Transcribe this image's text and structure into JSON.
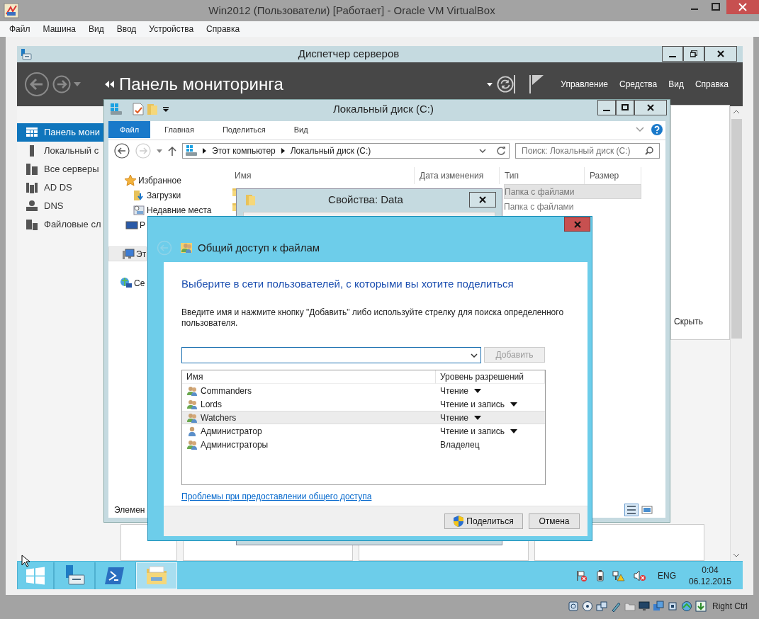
{
  "vbox": {
    "title": "Win2012 (Пользователи) [Работает] - Oracle VM VirtualBox",
    "menu": [
      "Файл",
      "Машина",
      "Вид",
      "Ввод",
      "Устройства",
      "Справка"
    ],
    "host_key": "Right Ctrl"
  },
  "server_manager": {
    "title": "Диспетчер серверов",
    "heading": "Панель мониторинга",
    "menu": [
      "Управление",
      "Средства",
      "Вид",
      "Справка"
    ],
    "sidebar": [
      {
        "label": "Панель мони",
        "kind": "dashboard",
        "selected": true
      },
      {
        "label": "Локальный с",
        "kind": "server",
        "selected": false
      },
      {
        "label": "Все серверы",
        "kind": "servers",
        "selected": false
      },
      {
        "label": "AD DS",
        "kind": "adds",
        "selected": false
      },
      {
        "label": "DNS",
        "kind": "dns",
        "selected": false
      },
      {
        "label": "Файловые сл",
        "kind": "files",
        "selected": false
      }
    ],
    "panel_link": "Скрыть"
  },
  "explorer": {
    "title": "Локальный диск (C:)",
    "ribbon_tabs": [
      {
        "label": "Файл",
        "selected": true
      },
      {
        "label": "Главная",
        "selected": false
      },
      {
        "label": "Поделиться",
        "selected": false
      },
      {
        "label": "Вид",
        "selected": false
      }
    ],
    "breadcrumb": [
      "Этот компьютер",
      "Локальный диск (C:)"
    ],
    "search": {
      "placeholder": "Поиск: Локальный диск (C:)"
    },
    "columns": [
      "Имя",
      "Дата изменения",
      "Тип",
      "Размер"
    ],
    "rows": [
      {
        "type": "Папка с файлами",
        "selected": true
      },
      {
        "type": "Папка с файлами",
        "selected": false
      }
    ],
    "nav": [
      {
        "label": "Избранное",
        "kind": "star",
        "selected": false
      },
      {
        "label": "Загрузки",
        "kind": "download",
        "selected": false
      },
      {
        "label": "Недавние места",
        "kind": "recent",
        "selected": false
      },
      {
        "label": "Р",
        "kind": "desktop",
        "selected": false
      },
      {
        "label": "Эт",
        "kind": "computer",
        "selected": true
      },
      {
        "label": "Се",
        "kind": "network",
        "selected": false
      }
    ],
    "status": "Элемен"
  },
  "properties": {
    "title": "Свойства: Data"
  },
  "share_dialog": {
    "title": "Общий доступ к файлам",
    "heading": "Выберите в сети пользователей, с которыми вы хотите поделиться",
    "instructions": "Введите имя и нажмите кнопку \"Добавить\" либо используйте стрелку для поиска определенного пользователя.",
    "add_button": {
      "label": "Добавить",
      "disabled": true
    },
    "columns": [
      "Имя",
      "Уровень разрешений"
    ],
    "entries": [
      {
        "name": "Commanders",
        "kind": "group",
        "permission": "Чтение",
        "dropdown": true,
        "selected": false
      },
      {
        "name": "Lords",
        "kind": "group",
        "permission": "Чтение и запись",
        "dropdown": true,
        "selected": false
      },
      {
        "name": "Watchers",
        "kind": "group",
        "permission": "Чтение",
        "dropdown": true,
        "selected": true
      },
      {
        "name": "Администратор",
        "kind": "user",
        "permission": "Чтение и запись",
        "dropdown": true,
        "selected": false
      },
      {
        "name": "Администраторы",
        "kind": "group",
        "permission": "Владелец",
        "dropdown": false,
        "selected": false
      }
    ],
    "link": "Проблемы при предоставлении общего доступа",
    "buttons": [
      {
        "label": "Поделиться",
        "kind": "shield"
      },
      {
        "label": "Отмена",
        "kind": "plain"
      }
    ]
  },
  "taskbar": {
    "apps": [
      {
        "kind": "start",
        "selected": false
      },
      {
        "kind": "server",
        "selected": false
      },
      {
        "kind": "powershell",
        "selected": false
      },
      {
        "kind": "explorer",
        "selected": true
      }
    ],
    "language": "ENG",
    "time": "0:04",
    "date": "06.12.2015"
  }
}
